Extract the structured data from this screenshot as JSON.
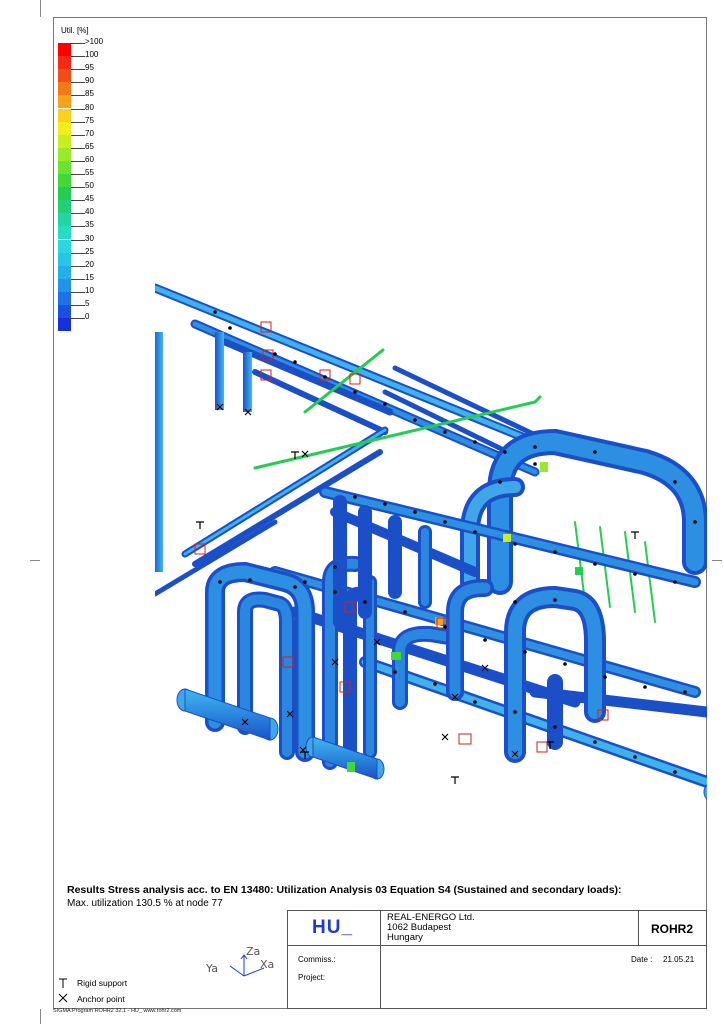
{
  "legend": {
    "title": "Util. [%]",
    "items": [
      {
        "label": ">100",
        "color": "#ff0000"
      },
      {
        "label": "100",
        "color": "#f42a14"
      },
      {
        "label": "95",
        "color": "#f34c18"
      },
      {
        "label": "90",
        "color": "#f4781a"
      },
      {
        "label": "85",
        "color": "#f8a21a"
      },
      {
        "label": "80",
        "color": "#fad21e"
      },
      {
        "label": "75",
        "color": "#f2ee1e"
      },
      {
        "label": "70",
        "color": "#c9ee22"
      },
      {
        "label": "65",
        "color": "#9aea2a"
      },
      {
        "label": "60",
        "color": "#6ae231"
      },
      {
        "label": "55",
        "color": "#42d838"
      },
      {
        "label": "50",
        "color": "#23cd52"
      },
      {
        "label": "45",
        "color": "#20cf77"
      },
      {
        "label": "40",
        "color": "#24d59f"
      },
      {
        "label": "35",
        "color": "#28dcc3"
      },
      {
        "label": "30",
        "color": "#2ad7de"
      },
      {
        "label": "25",
        "color": "#28c6e6"
      },
      {
        "label": "20",
        "color": "#24aeea"
      },
      {
        "label": "15",
        "color": "#2292ea"
      },
      {
        "label": "10",
        "color": "#1e72e6"
      },
      {
        "label": "5",
        "color": "#1a50e0"
      },
      {
        "label": "0",
        "color": "#1530d8"
      }
    ]
  },
  "caption": {
    "title": "Results Stress analysis acc. to EN 13480: Utilization Analysis 03  Equation S4 (Sustained and secondary loads):",
    "subtitle": "Max. utilization 130.5 % at node 77"
  },
  "titleblock": {
    "logo": "HU_",
    "company_line1": "REAL-ENERGO Ltd.",
    "company_line2": "1062 Budapest",
    "company_line3": "Hungary",
    "product": "ROHR2",
    "commiss_label": "Commiss.:",
    "project_label": "Project:",
    "date_label": "Date :",
    "date_value": "21.05.21"
  },
  "axes": {
    "za": "Za",
    "ya": "Ya",
    "xa": "Xa"
  },
  "symbols": {
    "rigid_support": "Rigid support",
    "anchor_point": "Anchor point"
  },
  "footer": "SIGMA Program ROHR2 32.1 - HU_   www.rohr2.com",
  "colors": {
    "pipe_main": "#2f8fe0",
    "pipe_dark": "#1f4fc8",
    "pipe_light": "#34b3ea",
    "frame": "#777777"
  }
}
